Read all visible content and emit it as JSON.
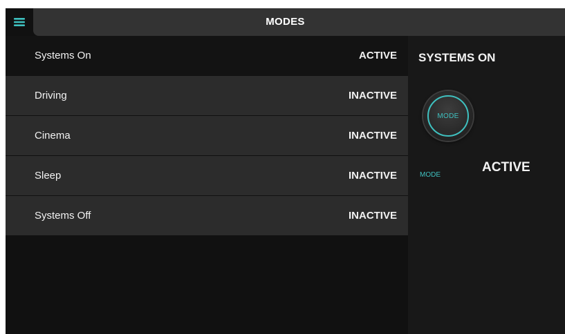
{
  "header": {
    "menu_icon": "hamburger-menu-icon",
    "title": "MODES"
  },
  "modes": [
    {
      "name": "Systems On",
      "status": "ACTIVE"
    },
    {
      "name": "Driving",
      "status": "INACTIVE"
    },
    {
      "name": "Cinema",
      "status": "INACTIVE"
    },
    {
      "name": "Sleep",
      "status": "INACTIVE"
    },
    {
      "name": "Systems Off",
      "status": "INACTIVE"
    }
  ],
  "panel": {
    "title": "SYSTEMS ON",
    "knob_label": "MODE",
    "mode_caption": "MODE",
    "mode_value": "ACTIVE"
  },
  "colors": {
    "accent": "#3fc1c0",
    "background": "#111111",
    "row_inactive": "#2c2c2c",
    "header": "#333333"
  }
}
